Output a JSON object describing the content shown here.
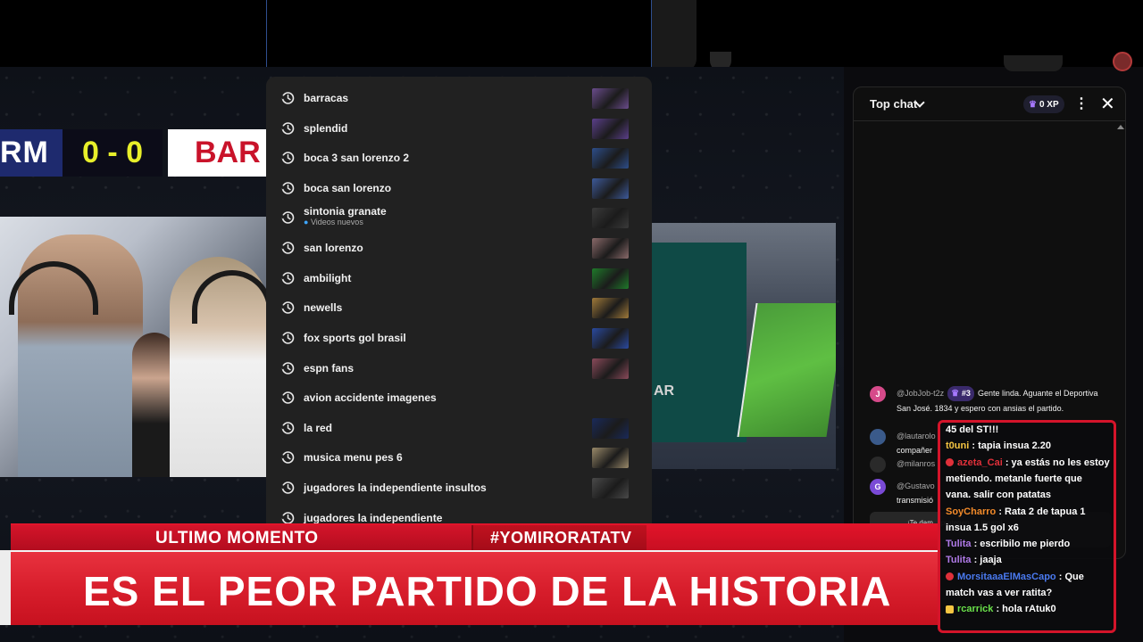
{
  "scoreboard": {
    "team_left": "RM",
    "score": "0 - 0",
    "team_right": "BAR"
  },
  "game_panel_text": "AR",
  "search_suggestions": [
    {
      "text": "barracas",
      "sub": "",
      "thumb_color": "#6a4c8c"
    },
    {
      "text": "splendid",
      "sub": "",
      "thumb_color": "#5b3f8a"
    },
    {
      "text": "boca 3 san lorenzo 2",
      "sub": "",
      "thumb_color": "#2d4e8a"
    },
    {
      "text": "boca san lorenzo",
      "sub": "",
      "thumb_color": "#3d5a9a"
    },
    {
      "text": "sintonia granate",
      "sub": "Videos nuevos",
      "thumb_color": "#3a3a3a"
    },
    {
      "text": "san lorenzo",
      "sub": "",
      "thumb_color": "#8a6a6a"
    },
    {
      "text": "ambilight",
      "sub": "",
      "thumb_color": "#1f7a2a"
    },
    {
      "text": "newells",
      "sub": "",
      "thumb_color": "#a07a3a"
    },
    {
      "text": "fox sports gol brasil",
      "sub": "",
      "thumb_color": "#2a4aa0"
    },
    {
      "text": "espn fans",
      "sub": "",
      "thumb_color": "#8a4a5a"
    },
    {
      "text": "avion accidente imagenes",
      "sub": "",
      "thumb_color": ""
    },
    {
      "text": "la red",
      "sub": "",
      "thumb_color": "#1a2a5a"
    },
    {
      "text": "musica menu pes 6",
      "sub": "",
      "thumb_color": "#9a8a6a"
    },
    {
      "text": "jugadores la independiente insultos",
      "sub": "",
      "thumb_color": "#4a4a4a"
    },
    {
      "text": "jugadores la independiente",
      "sub": "",
      "thumb_color": ""
    }
  ],
  "chat": {
    "title": "Top chat",
    "xp": "0 XP",
    "messages": [
      {
        "avatar": "J",
        "avatar_color": "#d64a8a",
        "author": "@JobJob-t2z",
        "badge": "#3",
        "text": "Gente linda. Aguante el Deportiva San José. 1834 y espero con ansias el partido."
      },
      {
        "avatar": "",
        "avatar_color": "#3a5a8a",
        "author": "@lautarolo",
        "badge": "",
        "text": "compañer"
      },
      {
        "avatar": "",
        "avatar_color": "#2a2a2a",
        "author": "@milanros",
        "badge": "",
        "text": ""
      },
      {
        "avatar": "G",
        "avatar_color": "#7a4ad6",
        "author": "@Gustavo",
        "badge": "",
        "text": "transmisió"
      }
    ],
    "pinned": "¡Te dam... protegen... Lineami..."
  },
  "overlay_chat": [
    {
      "user": "",
      "user_color": "#ffffff",
      "badge": "",
      "text": "45 del ST!!!"
    },
    {
      "user": "t0uni",
      "user_color": "#f5c542",
      "badge": "",
      "text": ": tapia insua 2.20"
    },
    {
      "user": "azeta_Cai",
      "user_color": "#e0303a",
      "badge": "#e0303a",
      "text": ": ya estás no les estoy"
    },
    {
      "user": "",
      "user_color": "#ffffff",
      "badge": "",
      "text": "metiendo. metanle fuerte que"
    },
    {
      "user": "",
      "user_color": "#ffffff",
      "badge": "",
      "text": "vana. salir con patatas"
    },
    {
      "user": "SoyCharro",
      "user_color": "#f28a2a",
      "badge": "",
      "text": ": Rata 2 de tapua 1"
    },
    {
      "user": "",
      "user_color": "#ffffff",
      "badge": "",
      "text": "insua 1.5 gol x6"
    },
    {
      "user": "Tulita",
      "user_color": "#b07ae8",
      "badge": "",
      "text": ": escribilo me pierdo"
    },
    {
      "user": "Tulita",
      "user_color": "#b07ae8",
      "badge": "",
      "text": ": jaaja"
    },
    {
      "user": "MorsitaaaElMasCapo",
      "user_color": "#4a7af0",
      "badge": "#e0303a",
      "text": ": Que"
    },
    {
      "user": "",
      "user_color": "#ffffff",
      "badge": "",
      "text": "match vas a ver ratita?"
    },
    {
      "user": "rcarrick",
      "user_color": "#6ae04a",
      "badge": "#f5c542",
      "text": ": hola rAtuk0"
    }
  ],
  "banner": {
    "label": "ULTIMO MOMENTO",
    "hashtag": "#YOMIRORATATV",
    "headline": "ES EL PEOR PARTIDO DE LA HISTORIA"
  }
}
